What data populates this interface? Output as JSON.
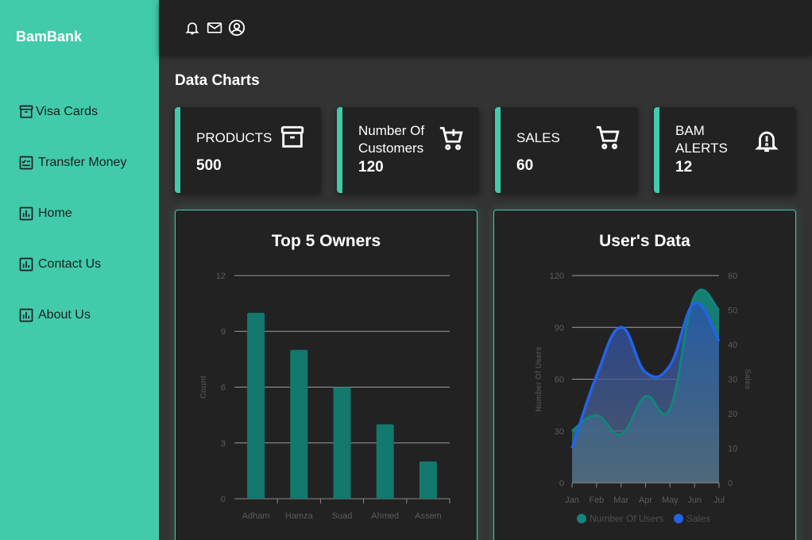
{
  "app": {
    "brand": "BamBank"
  },
  "sidebar": {
    "items": [
      {
        "label": "Visa Cards",
        "icon": "archive-icon"
      },
      {
        "label": "Transfer Money",
        "icon": "checklist-icon"
      },
      {
        "label": "Home",
        "icon": "bar-chart-icon"
      },
      {
        "label": "Contact Us",
        "icon": "bar-chart-icon"
      },
      {
        "label": "About Us",
        "icon": "bar-chart-icon"
      }
    ]
  },
  "topbar": {
    "icons": [
      "bell-icon",
      "mail-icon",
      "user-circle-icon"
    ]
  },
  "page": {
    "title": "Data Charts"
  },
  "cards": [
    {
      "label_lines": [
        "PRODUCTS"
      ],
      "value": "500",
      "icon": "archive-icon"
    },
    {
      "label_lines": [
        "Number Of",
        "Customers"
      ],
      "value": "120",
      "icon": "cart-plus-icon"
    },
    {
      "label_lines": [
        "SALES"
      ],
      "value": "60",
      "icon": "cart-icon"
    },
    {
      "label_lines": [
        "BAM",
        "ALERTS"
      ],
      "value": "12",
      "icon": "bell-alert-icon"
    }
  ],
  "colors": {
    "accent": "#41cbab",
    "bar": "#13786d",
    "users_line": "#13857a",
    "sales_line": "#2463e6",
    "panel_bg": "#222222",
    "page_bg": "#333333"
  },
  "chart_data": [
    {
      "type": "bar",
      "title": "Top 5 Owners",
      "categories": [
        "Adham",
        "Hamza",
        "Suad",
        "Ahmed",
        "Assem"
      ],
      "values": [
        10,
        8,
        6,
        4,
        2
      ],
      "ylabel": "Count",
      "xlabel": "",
      "ylim": [
        0,
        12
      ],
      "yticks": [
        "0",
        "3",
        "6",
        "9",
        "12"
      ],
      "grid": true
    },
    {
      "type": "area",
      "title": "User's Data",
      "categories": [
        "Jan",
        "Feb",
        "Mar",
        "Apr",
        "May",
        "Jun",
        "Jul"
      ],
      "series": [
        {
          "name": "Number Of Users",
          "axis": "left",
          "values": [
            30,
            39,
            28,
            50,
            43,
            108,
            100
          ]
        },
        {
          "name": "Sales",
          "axis": "right",
          "values": [
            10,
            31,
            45,
            32,
            34,
            52,
            41
          ]
        }
      ],
      "ylabel": "Number Of Users",
      "y2label": "Sales",
      "ylim": [
        0,
        120
      ],
      "y2lim": [
        0,
        60
      ],
      "yticks": [
        "0",
        "30",
        "60",
        "90",
        "120"
      ],
      "y2ticks": [
        "0",
        "10",
        "20",
        "30",
        "40",
        "50",
        "60"
      ],
      "legend": "bottom"
    }
  ]
}
